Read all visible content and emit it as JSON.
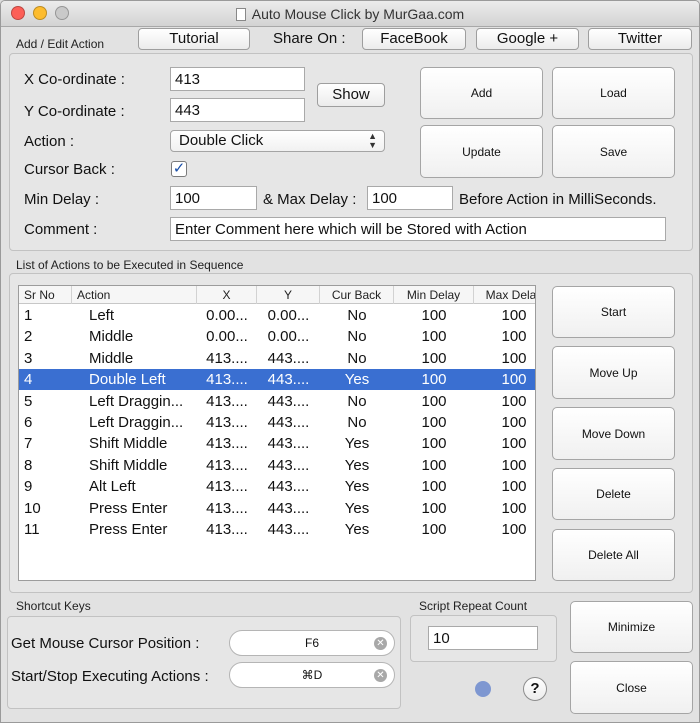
{
  "window": {
    "title": "Auto Mouse Click by MurGaa.com"
  },
  "add_edit": {
    "section_label": "Add / Edit Action",
    "tutorial_label": "Tutorial",
    "share_on_label": "Share On :",
    "facebook_label": "FaceBook",
    "google_label": "Google +",
    "twitter_label": "Twitter",
    "x_label": "X Co-ordinate :",
    "x_value": "413",
    "y_label": "Y Co-ordinate :",
    "y_value": "443",
    "show_label": "Show",
    "action_label": "Action :",
    "action_value": "Double Click",
    "cursor_back_label": "Cursor Back :",
    "cursor_back_checked": "✓",
    "min_delay_label": "Min Delay :",
    "min_delay_value": "100",
    "max_delay_label": "& Max Delay :",
    "max_delay_value": "100",
    "delay_suffix": "Before Action in MilliSeconds.",
    "comment_label": "Comment :",
    "comment_value": "Enter Comment here which will be Stored with Action",
    "add_label": "Add",
    "load_label": "Load",
    "update_label": "Update",
    "save_label": "Save"
  },
  "list": {
    "section_label": "List of Actions to be Executed in Sequence",
    "columns": [
      "Sr No",
      "Action",
      "X",
      "Y",
      "Cur Back",
      "Min Delay",
      "Max Delay"
    ],
    "rows": [
      [
        "1",
        "Left",
        "0.00...",
        "0.00...",
        "No",
        "100",
        "100"
      ],
      [
        "2",
        "Middle",
        "0.00...",
        "0.00...",
        "No",
        "100",
        "100"
      ],
      [
        "3",
        "Middle",
        "413....",
        "443....",
        "No",
        "100",
        "100"
      ],
      [
        "4",
        "Double Left",
        "413....",
        "443....",
        "Yes",
        "100",
        "100"
      ],
      [
        "5",
        "Left Draggin...",
        "413....",
        "443....",
        "No",
        "100",
        "100"
      ],
      [
        "6",
        "Left Draggin...",
        "413....",
        "443....",
        "No",
        "100",
        "100"
      ],
      [
        "7",
        "Shift Middle",
        "413....",
        "443....",
        "Yes",
        "100",
        "100"
      ],
      [
        "8",
        "Shift Middle",
        "413....",
        "443....",
        "Yes",
        "100",
        "100"
      ],
      [
        "9",
        "Alt Left",
        "413....",
        "443....",
        "Yes",
        "100",
        "100"
      ],
      [
        "10",
        "Press Enter",
        "413....",
        "443....",
        "Yes",
        "100",
        "100"
      ],
      [
        "11",
        "Press Enter",
        "413....",
        "443....",
        "Yes",
        "100",
        "100"
      ]
    ],
    "selected_row": "4",
    "start_label": "Start",
    "move_up_label": "Move Up",
    "move_down_label": "Move Down",
    "delete_label": "Delete",
    "delete_all_label": "Delete All"
  },
  "shortcuts": {
    "section_label": "Shortcut Keys",
    "get_cursor_label": "Get Mouse Cursor Position :",
    "get_cursor_key": "F6",
    "start_stop_label": "Start/Stop Executing Actions :",
    "start_stop_key": "⌘D"
  },
  "repeat": {
    "section_label": "Script Repeat Count",
    "value": "10"
  },
  "footer": {
    "help_label": "?",
    "minimize_label": "Minimize",
    "close_label": "Close"
  },
  "colors": {
    "selection": "#3a6fd1",
    "status_dot": "#7e97d1"
  }
}
